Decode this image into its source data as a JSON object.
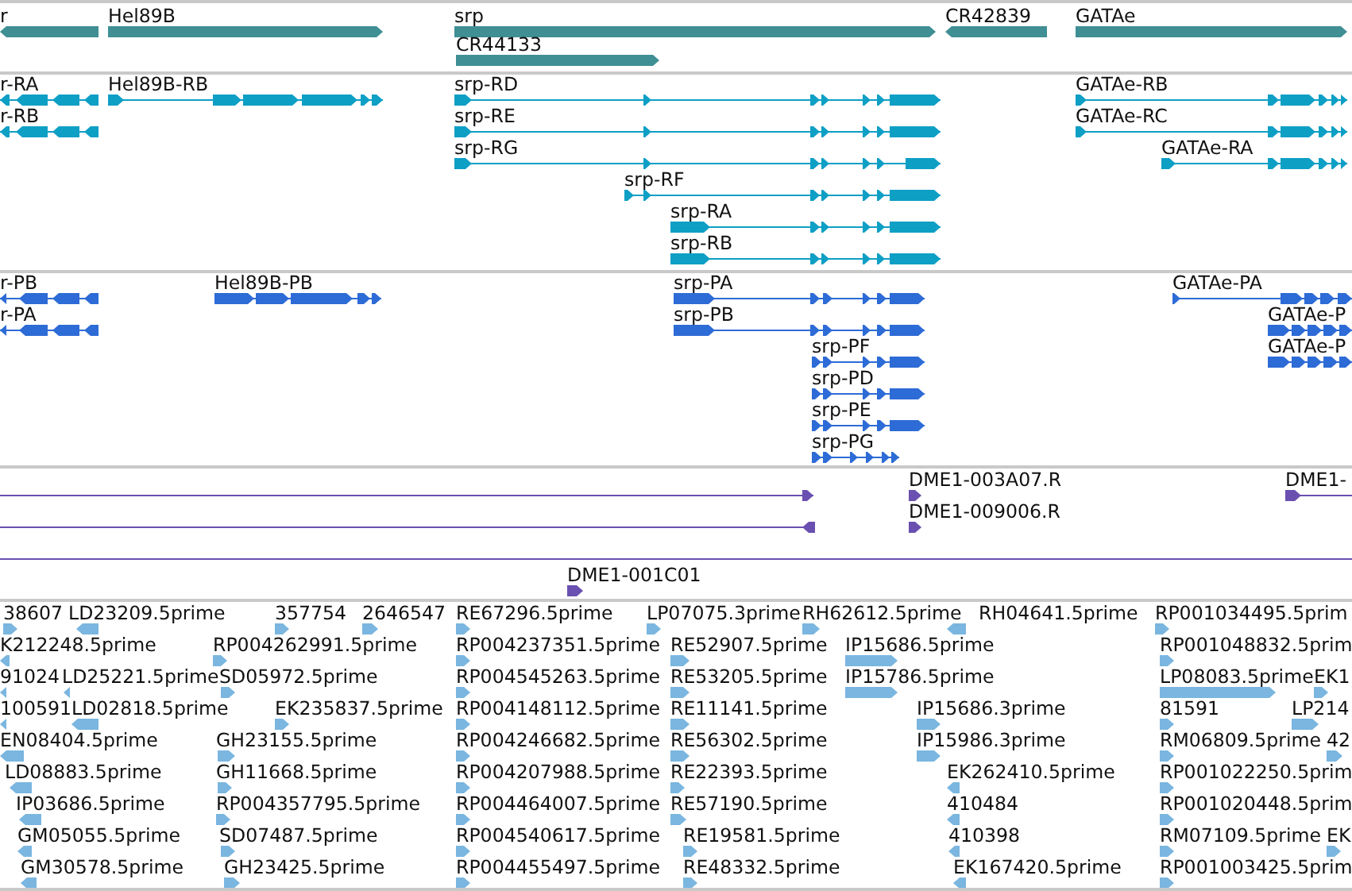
{
  "tracks": [
    {
      "kind": "gene",
      "features": [
        {
          "label": "r",
          "reverse_strand": true
        },
        {
          "label": "Hel89B",
          "reverse_strand": false
        },
        {
          "label": "srp",
          "reverse_strand": false
        },
        {
          "label": "CR44133",
          "reverse_strand": false
        },
        {
          "label": "CR42839",
          "reverse_strand": true
        },
        {
          "label": "GATAe",
          "reverse_strand": false
        }
      ]
    },
    {
      "kind": "transcript",
      "features": [
        {
          "label": "r-RA",
          "reverse_strand": true
        },
        {
          "label": "r-RB",
          "reverse_strand": true
        },
        {
          "label": "Hel89B-RB",
          "reverse_strand": false
        },
        {
          "label": "srp-RD",
          "reverse_strand": false
        },
        {
          "label": "srp-RE",
          "reverse_strand": false
        },
        {
          "label": "srp-RG",
          "reverse_strand": false
        },
        {
          "label": "srp-RF",
          "reverse_strand": false
        },
        {
          "label": "srp-RA",
          "reverse_strand": false
        },
        {
          "label": "srp-RB",
          "reverse_strand": false
        },
        {
          "label": "GATAe-RB",
          "reverse_strand": false
        },
        {
          "label": "GATAe-RC",
          "reverse_strand": false
        },
        {
          "label": "GATAe-RA",
          "reverse_strand": false
        }
      ]
    },
    {
      "kind": "protein",
      "features": [
        {
          "label": "r-PB",
          "reverse_strand": true
        },
        {
          "label": "r-PA",
          "reverse_strand": true
        },
        {
          "label": "Hel89B-PB",
          "reverse_strand": false
        },
        {
          "label": "srp-PA",
          "reverse_strand": false
        },
        {
          "label": "srp-PB",
          "reverse_strand": false
        },
        {
          "label": "srp-PF",
          "reverse_strand": false
        },
        {
          "label": "srp-PD",
          "reverse_strand": false
        },
        {
          "label": "srp-PE",
          "reverse_strand": false
        },
        {
          "label": "srp-PG",
          "reverse_strand": false
        },
        {
          "label": "GATAe-PA",
          "reverse_strand": false
        },
        {
          "label": "GATAe-P",
          "reverse_strand": false
        },
        {
          "label": "GATAe-P",
          "reverse_strand": false
        }
      ]
    },
    {
      "kind": "clone",
      "features": [
        {
          "kind": "line",
          "reverse_strand": false
        },
        {
          "kind": "line",
          "reverse_strand": true
        },
        {
          "kind": "marker",
          "label": "DME1-003A07.R",
          "reverse_strand": false
        },
        {
          "kind": "marker",
          "label": "DME1-009006.R",
          "reverse_strand": false
        },
        {
          "kind": "line",
          "label": "DME1-",
          "reverse_strand": false
        },
        {
          "kind": "line"
        },
        {
          "kind": "marker",
          "label": "DME1-001C01",
          "reverse_strand": false
        }
      ]
    },
    {
      "kind": "est",
      "features": [
        {
          "label": "38607",
          "reverse_strand": false
        },
        {
          "label": "LD23209.5prime",
          "reverse_strand": true
        },
        {
          "label": "357754",
          "reverse_strand": false
        },
        {
          "label": "2646547",
          "reverse_strand": false
        },
        {
          "label": "RE67296.5prime",
          "reverse_strand": false
        },
        {
          "label": "LP07075.3prime",
          "reverse_strand": false
        },
        {
          "label": "RH62612.5prime",
          "reverse_strand": false
        },
        {
          "label": "RH04641.5prime",
          "reverse_strand": true
        },
        {
          "label": "RP001034495.5prim",
          "reverse_strand": false
        },
        {
          "label": "K212248.5prime",
          "reverse_strand": true
        },
        {
          "label": "RP004262991.5prime",
          "reverse_strand": false
        },
        {
          "label": "RP004237351.5prime",
          "reverse_strand": false
        },
        {
          "label": "RE52907.5prime",
          "reverse_strand": false
        },
        {
          "label": "IP15686.5prime",
          "reverse_strand": false
        },
        {
          "label": "RP001048832.5prim",
          "reverse_strand": false
        },
        {
          "label": "91024",
          "reverse_strand": true
        },
        {
          "label": "LD25221.5prime",
          "reverse_strand": true
        },
        {
          "label": "SD05972.5prime",
          "reverse_strand": false
        },
        {
          "label": "RP004545263.5prime",
          "reverse_strand": false
        },
        {
          "label": "RE53205.5prime",
          "reverse_strand": false
        },
        {
          "label": "IP15786.5prime",
          "reverse_strand": false
        },
        {
          "label": "LP08083.5prime",
          "reverse_strand": false
        },
        {
          "label": "EK1",
          "reverse_strand": false
        },
        {
          "label": "100591",
          "reverse_strand": true
        },
        {
          "label": "LD02818.5prime",
          "reverse_strand": true
        },
        {
          "label": "EK235837.5prime",
          "reverse_strand": false
        },
        {
          "label": "RP004148112.5prime",
          "reverse_strand": false
        },
        {
          "label": "RE11141.5prime",
          "reverse_strand": false
        },
        {
          "label": "IP15686.3prime",
          "reverse_strand": false
        },
        {
          "label": "81591",
          "reverse_strand": false
        },
        {
          "label": "LP214",
          "reverse_strand": false
        },
        {
          "label": "EN08404.5prime",
          "reverse_strand": true
        },
        {
          "label": "GH23155.5prime",
          "reverse_strand": false
        },
        {
          "label": "RP004246682.5prime",
          "reverse_strand": false
        },
        {
          "label": "RE56302.5prime",
          "reverse_strand": false
        },
        {
          "label": "IP15986.3prime",
          "reverse_strand": false
        },
        {
          "label": "RM06809.5prime",
          "reverse_strand": false
        },
        {
          "label": "42",
          "reverse_strand": false
        },
        {
          "label": "LD08883.5prime",
          "reverse_strand": true
        },
        {
          "label": "GH11668.5prime",
          "reverse_strand": false
        },
        {
          "label": "RP004207988.5prime",
          "reverse_strand": false
        },
        {
          "label": "RE22393.5prime",
          "reverse_strand": false
        },
        {
          "label": "EK262410.5prime",
          "reverse_strand": true
        },
        {
          "label": "RP001022250.5prim",
          "reverse_strand": false
        },
        {
          "label": "IP03686.5prime",
          "reverse_strand": true
        },
        {
          "label": "RP004357795.5prime",
          "reverse_strand": false
        },
        {
          "label": "RP004464007.5prime",
          "reverse_strand": false
        },
        {
          "label": "RE57190.5prime",
          "reverse_strand": false
        },
        {
          "label": "410484",
          "reverse_strand": true
        },
        {
          "label": "RP001020448.5prim",
          "reverse_strand": false
        },
        {
          "label": "GM05055.5prime",
          "reverse_strand": true
        },
        {
          "label": "SD07487.5prime",
          "reverse_strand": false
        },
        {
          "label": "RP004540617.5prime",
          "reverse_strand": false
        },
        {
          "label": "RE19581.5prime",
          "reverse_strand": false
        },
        {
          "label": "410398",
          "reverse_strand": true
        },
        {
          "label": "RM07109.5prime",
          "reverse_strand": false
        },
        {
          "label": "EK",
          "reverse_strand": false
        },
        {
          "label": "GM30578.5prime",
          "reverse_strand": true
        },
        {
          "label": "GH23425.5prime",
          "reverse_strand": false
        },
        {
          "label": "RP004455497.5prime",
          "reverse_strand": false
        },
        {
          "label": "RE48332.5prime",
          "reverse_strand": false
        },
        {
          "label": "EK167420.5prime",
          "reverse_strand": true
        },
        {
          "label": "RP001003425.5prim",
          "reverse_strand": false
        }
      ]
    }
  ]
}
